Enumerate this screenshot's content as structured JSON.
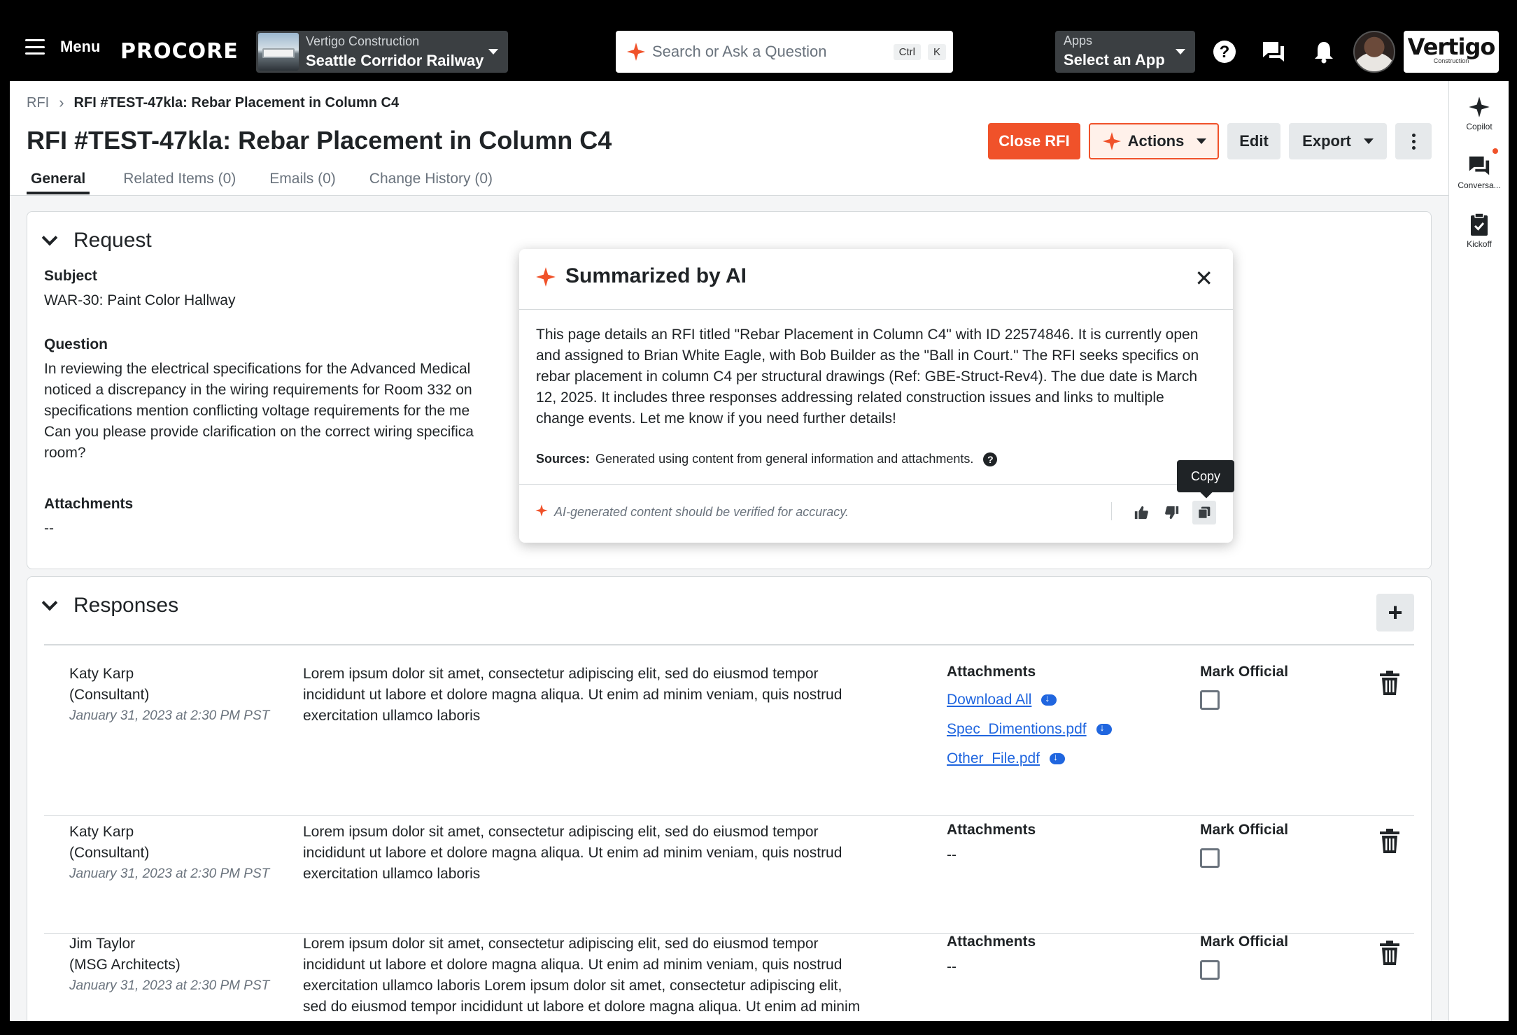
{
  "topnav": {
    "menu_label": "Menu",
    "logo": "PROCORE",
    "project_company": "Vertigo Construction",
    "project_name": "Seattle Corridor Railway",
    "search_placeholder": "Search or Ask a Question",
    "kbd_ctrl": "Ctrl",
    "kbd_k": "K",
    "apps_label": "Apps",
    "apps_value": "Select an App",
    "brand_name": "Vertigo",
    "brand_sub": "Construction"
  },
  "breadcrumb": {
    "root": "RFI",
    "current": "RFI #TEST-47kla: Rebar Placement in Column C4"
  },
  "page_title": "RFI #TEST-47kla: Rebar Placement in Column C4",
  "header_buttons": {
    "close": "Close RFI",
    "actions": "Actions",
    "edit": "Edit",
    "export": "Export"
  },
  "tabs": [
    {
      "label": "General"
    },
    {
      "label": "Related Items (0)"
    },
    {
      "label": "Emails (0)"
    },
    {
      "label": "Change History (0)"
    }
  ],
  "request": {
    "title": "Request",
    "subject_label": "Subject",
    "subject_value": "WAR-30: Paint Color Hallway",
    "question_label": "Question",
    "question_lines": [
      "In reviewing the electrical specifications for the Advanced Medical",
      "noticed a discrepancy in the wiring requirements for Room 332 on",
      "specifications mention conflicting voltage requirements for the me",
      "Can you please provide clarification on the correct wiring specifica",
      "room?"
    ],
    "attachments_label": "Attachments",
    "attachments_value": "--"
  },
  "responses": {
    "title": "Responses",
    "add_label": "+",
    "attachments_label": "Attachments",
    "mark_official_label": "Mark Official",
    "items": [
      {
        "name": "Katy Karp",
        "role": "(Consultant)",
        "date": "January 31, 2023 at 2:30 PM PST",
        "text_lines": [
          "Lorem ipsum dolor sit amet, consectetur adipiscing elit, sed do eiusmod tempor",
          "incididunt ut labore et dolore magna aliqua. Ut enim ad minim veniam, quis nostrud",
          "exercitation ullamco laboris"
        ],
        "attachments": [
          "Download All",
          "Spec_Dimentions.pdf",
          "Other_File.pdf"
        ]
      },
      {
        "name": "Katy Karp",
        "role": "(Consultant)",
        "date": "January 31, 2023 at 2:30 PM PST",
        "text_lines": [
          "Lorem ipsum dolor sit amet, consectetur adipiscing elit, sed do eiusmod tempor",
          "incididunt ut labore et dolore magna aliqua. Ut enim ad minim veniam, quis nostrud",
          "exercitation ullamco laboris"
        ],
        "attachments_value": "--"
      },
      {
        "name": "Jim Taylor",
        "role": "(MSG Architects)",
        "date": "January 31, 2023 at 2:30 PM PST",
        "text_lines": [
          "Lorem ipsum dolor sit amet, consectetur adipiscing elit, sed do eiusmod tempor",
          "incididunt ut labore et dolore magna aliqua. Ut enim ad minim veniam, quis nostrud",
          "exercitation ullamco laboris Lorem ipsum dolor sit amet, consectetur adipiscing elit,",
          "sed do eiusmod tempor incididunt ut labore et dolore magna aliqua. Ut enim ad minim"
        ],
        "attachments_value": "--"
      }
    ]
  },
  "ai_popover": {
    "title": "Summarized by AI",
    "close": "✕",
    "body": "This page details an RFI titled \"Rebar Placement in Column C4\" with ID 22574846. It is currently open and assigned to Brian White Eagle, with Bob Builder as the \"Ball in Court.\" The RFI seeks specifics on rebar placement in column C4 per structural drawings (Ref: GBE-Struct-Rev4). The due date is March 12, 2025. It includes three responses addressing related construction issues and links to multiple change events. Let me know if you need further details!",
    "sources_label": "Sources:",
    "sources_text": "Generated using content from general information and attachments.",
    "disclaimer": "AI-generated content should be verified for accuracy.",
    "tooltip": "Copy"
  },
  "rail": [
    {
      "label": "Copilot",
      "icon": "copilot-icon"
    },
    {
      "label": "Conversa...",
      "icon": "chat-icon"
    },
    {
      "label": "Kickoff",
      "icon": "clipboard-check-icon"
    }
  ],
  "colors": {
    "accent": "#f0522a",
    "link": "#2066df",
    "text": "#1f2326",
    "muted": "#6a737d"
  }
}
